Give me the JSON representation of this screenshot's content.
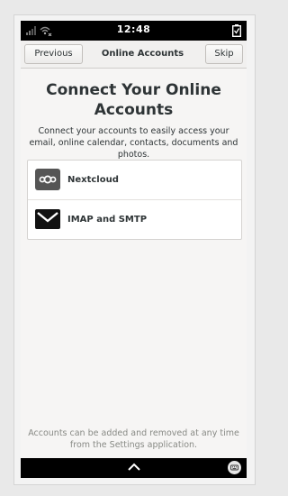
{
  "status_bar": {
    "time": "12:48",
    "icons": [
      "signal-icon",
      "wifi-icon",
      "battery-icon"
    ]
  },
  "header_bar": {
    "previous_label": "Previous",
    "title": "Online Accounts",
    "skip_label": "Skip"
  },
  "main": {
    "title": "Connect Your Online Accounts",
    "subtitle": "Connect your accounts to easily access your email, online calendar, contacts, documents and photos.",
    "accounts": [
      {
        "label": "Nextcloud",
        "icon": "nextcloud-icon"
      },
      {
        "label": "IMAP and SMTP",
        "icon": "mail-icon"
      }
    ],
    "footer_note": "Accounts can be added and removed at any time from the Settings application."
  },
  "nav_bar": {
    "icons": [
      "chevron-up-icon",
      "keyboard-icon"
    ]
  },
  "colors": {
    "text": "#2e3436",
    "muted_text": "#888a85",
    "background": "#f6f5f4",
    "bars": "#000000",
    "nextcloud_icon_bg": "#555555"
  }
}
